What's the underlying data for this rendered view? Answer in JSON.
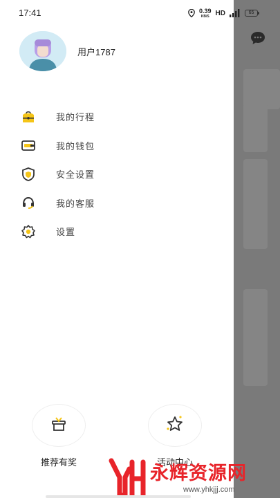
{
  "status_bar": {
    "time": "17:41",
    "net_speed_value": "0.39",
    "net_speed_unit": "KB/S",
    "hd": "HD",
    "battery": "65"
  },
  "profile": {
    "username": "用户1787"
  },
  "menu": {
    "items": [
      {
        "label": "我的行程",
        "icon": "trip-bag-icon"
      },
      {
        "label": "我的钱包",
        "icon": "wallet-icon"
      },
      {
        "label": "安全设置",
        "icon": "shield-icon"
      },
      {
        "label": "我的客服",
        "icon": "headset-icon"
      },
      {
        "label": "设置",
        "icon": "gear-icon"
      }
    ]
  },
  "bottom_actions": {
    "referral_label": "推荐有奖",
    "events_label": "活动中心"
  },
  "watermark": {
    "text": "永辉资源网",
    "url": "www.yhkjjj.com"
  },
  "colors": {
    "accent": "#f5c518",
    "dark": "#333333",
    "overlay": "#7a7a7a",
    "watermark_red": "#e8242a"
  }
}
